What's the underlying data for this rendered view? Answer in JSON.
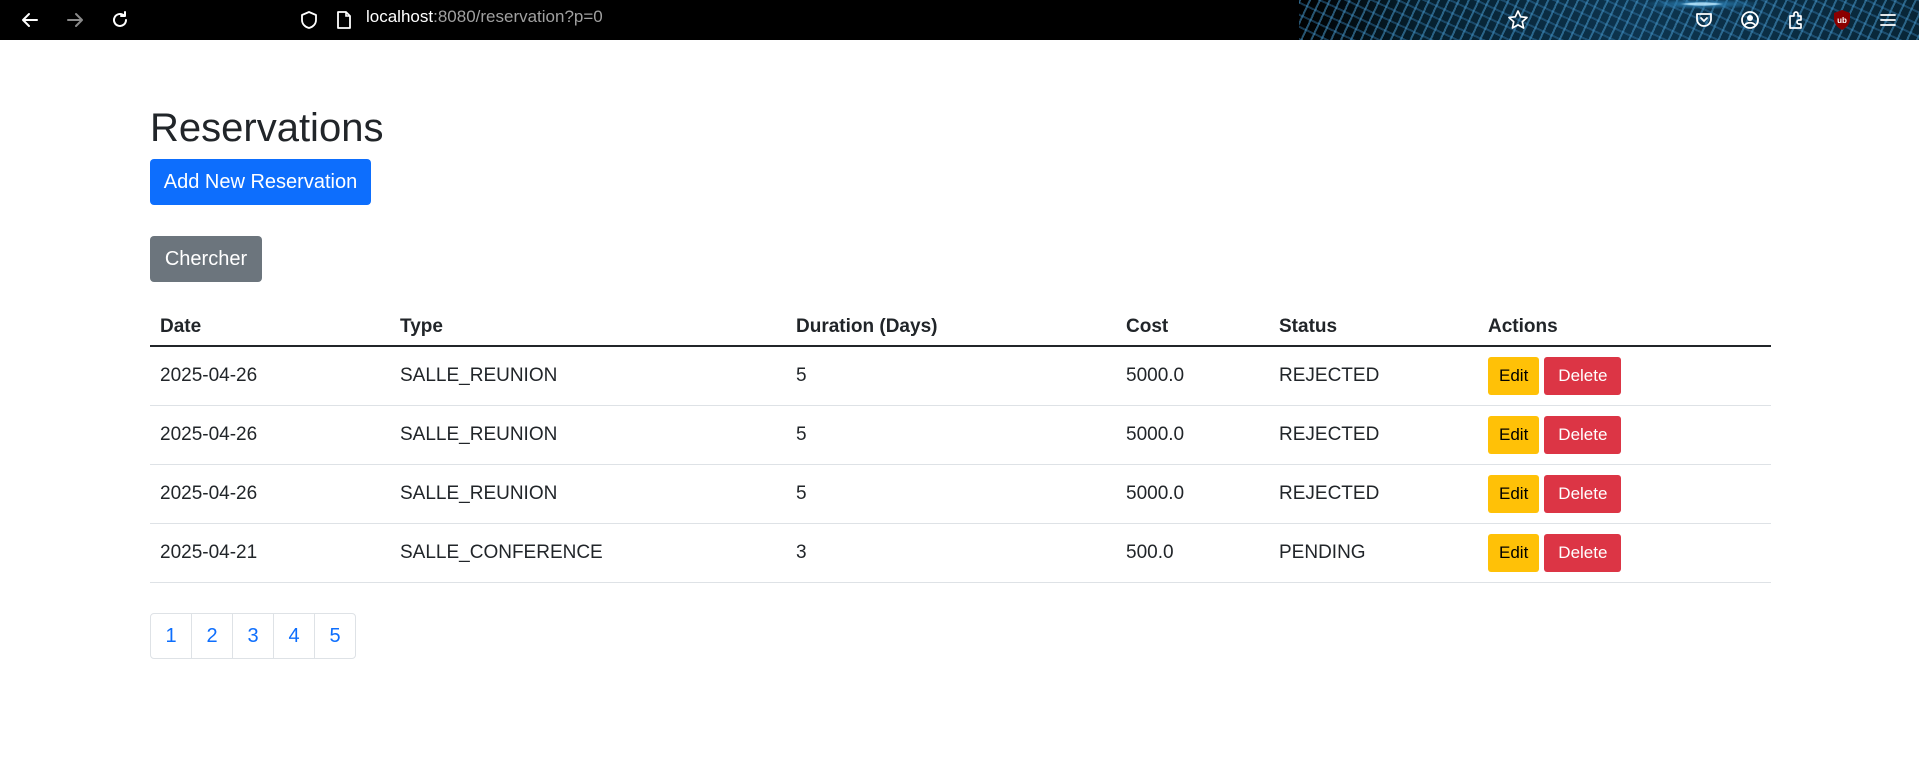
{
  "browser": {
    "url_host": "localhost",
    "url_rest": ":8080/reservation?p=0",
    "icons": [
      "back-arrow-icon",
      "forward-arrow-icon",
      "reload-icon",
      "shield-icon",
      "page-icon",
      "star-icon",
      "pocket-icon",
      "account-icon",
      "extensions-icon",
      "ublock-icon",
      "menu-icon"
    ]
  },
  "page": {
    "title": "Reservations",
    "add_button": "Add New Reservation",
    "search_button": "Chercher"
  },
  "table": {
    "headers": [
      "Date",
      "Type",
      "Duration (Days)",
      "Cost",
      "Status",
      "Actions"
    ],
    "rows": [
      {
        "date": "2025-04-26",
        "type": "SALLE_REUNION",
        "duration": "5",
        "cost": "5000.0",
        "status": "REJECTED"
      },
      {
        "date": "2025-04-26",
        "type": "SALLE_REUNION",
        "duration": "5",
        "cost": "5000.0",
        "status": "REJECTED"
      },
      {
        "date": "2025-04-26",
        "type": "SALLE_REUNION",
        "duration": "5",
        "cost": "5000.0",
        "status": "REJECTED"
      },
      {
        "date": "2025-04-21",
        "type": "SALLE_CONFERENCE",
        "duration": "3",
        "cost": "500.0",
        "status": "PENDING"
      }
    ],
    "edit_label": "Edit",
    "delete_label": "Delete"
  },
  "pagination": [
    "1",
    "2",
    "3",
    "4",
    "5"
  ],
  "colors": {
    "primary": "#0d6efd",
    "secondary": "#6c757d",
    "warning": "#ffc107",
    "danger": "#dc3545"
  }
}
